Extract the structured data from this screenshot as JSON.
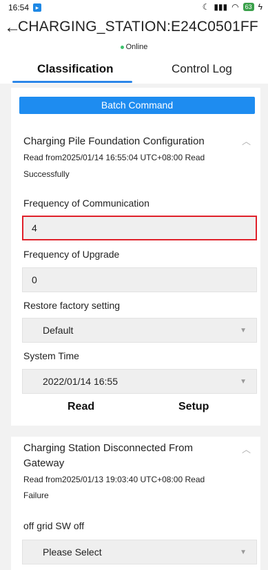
{
  "status_bar": {
    "time": "16:54",
    "battery": "63"
  },
  "header": {
    "back_icon": "←",
    "title": "CHARGING_STATION:E24C0501FF",
    "status": "Online"
  },
  "tabs": [
    {
      "label": "Classification",
      "active": true
    },
    {
      "label": "Control Log",
      "active": false
    }
  ],
  "batch_button": "Batch Command",
  "card1": {
    "title": "Charging Pile Foundation Configuration",
    "read_info_line1": "Read from2025/01/14 16:55:04 UTC+08:00   Read",
    "read_info_line2": "Successfully",
    "fields": {
      "freq_comm_label": "Frequency of Communication",
      "freq_comm_value": "4",
      "freq_upgrade_label": "Frequency of Upgrade",
      "freq_upgrade_value": "0",
      "restore_label": "Restore factory setting",
      "restore_value": "Default",
      "system_time_label": "System Time",
      "system_time_value": "2022/01/14 16:55"
    },
    "read_button": "Read",
    "setup_button": "Setup"
  },
  "card2": {
    "title_line1": "Charging Station Disconnected From",
    "title_line2": "Gateway",
    "read_info_line1": "Read from2025/01/13 19:03:40 UTC+08:00   Read",
    "read_info_line2": "Failure",
    "offgrid_label": "off grid SW off",
    "offgrid_value": "Please Select"
  },
  "colors": {
    "accent": "#1e8cf0",
    "highlight_border": "#e0202a",
    "online_dot": "#3ec26d"
  }
}
